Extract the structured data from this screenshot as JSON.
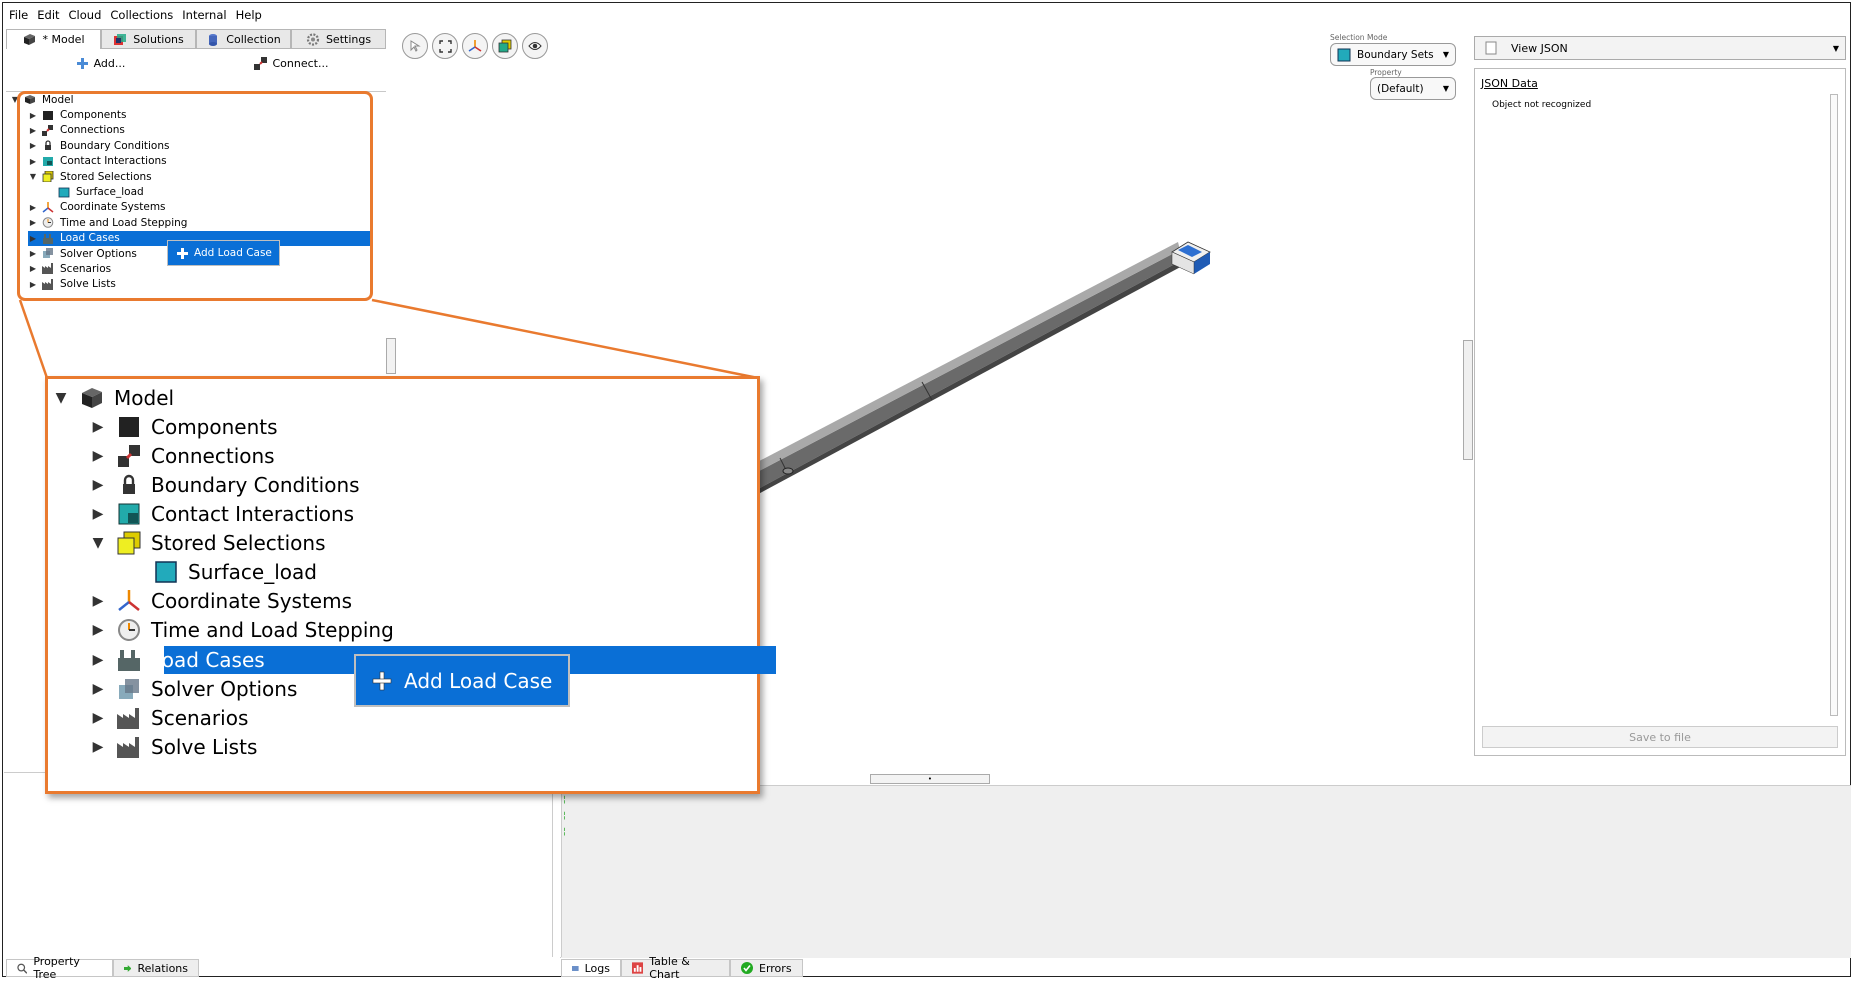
{
  "menu": [
    "File",
    "Edit",
    "Cloud",
    "Collections",
    "Internal",
    "Help"
  ],
  "tabs": {
    "model": "* Model",
    "solutions": "Solutions",
    "collection": "Collection",
    "settings": "Settings"
  },
  "toolbar": {
    "add": "Add...",
    "connect": "Connect..."
  },
  "tree": {
    "root": "Model",
    "items": [
      "Components",
      "Connections",
      "Boundary Conditions",
      "Contact Interactions",
      "Stored Selections",
      "Surface_load",
      "Coordinate Systems",
      "Time and Load Stepping",
      "Load Cases",
      "Solver Options",
      "Scenarios",
      "Solve Lists"
    ]
  },
  "context_menu": {
    "add_load_case": "Add Load Case"
  },
  "viewport": {
    "selection_mode_label": "Selection Mode",
    "selection_mode_value": "Boundary Sets",
    "property_label": "Property",
    "property_value": "(Default)"
  },
  "right_panel": {
    "view_combo": "View JSON",
    "json_title": "JSON Data",
    "json_text": "Object not recognized",
    "save_button": "Save to file"
  },
  "bottom_tabs_left": {
    "property_tree": "Property Tree",
    "relations": "Relations"
  },
  "bottom_tabs_right": {
    "logs": "Logs",
    "table_chart": "Table & Chart",
    "errors": "Errors"
  },
  "colors": {
    "accent": "#0a6fd6",
    "highlight": "#e97a2f"
  }
}
